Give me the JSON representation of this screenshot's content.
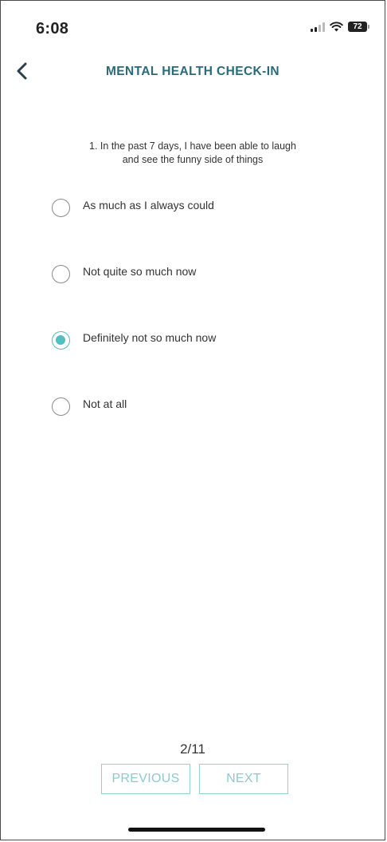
{
  "status_bar": {
    "time": "6:08",
    "battery_level": "72",
    "icons": [
      "cellular-signal-icon",
      "wifi-icon",
      "battery-icon"
    ]
  },
  "header": {
    "title": "MENTAL HEALTH CHECK-IN",
    "back_icon": "chevron-left-icon"
  },
  "question": {
    "line1": "1. In the past 7 days, I have been able to laugh",
    "line2": "and see the funny side of things"
  },
  "options": [
    {
      "label": "As much as I always could",
      "selected": false
    },
    {
      "label": "Not quite so much now",
      "selected": false
    },
    {
      "label": "Definitely not so much now",
      "selected": true
    },
    {
      "label": "Not at all",
      "selected": false
    }
  ],
  "footer": {
    "page_indicator": "2/11",
    "previous_label": "PREVIOUS",
    "next_label": "NEXT"
  },
  "colors": {
    "accent": "#4fbfbf",
    "title": "#2a6a79",
    "button_border": "#8ed3d3",
    "button_text": "#8ec9cc"
  }
}
